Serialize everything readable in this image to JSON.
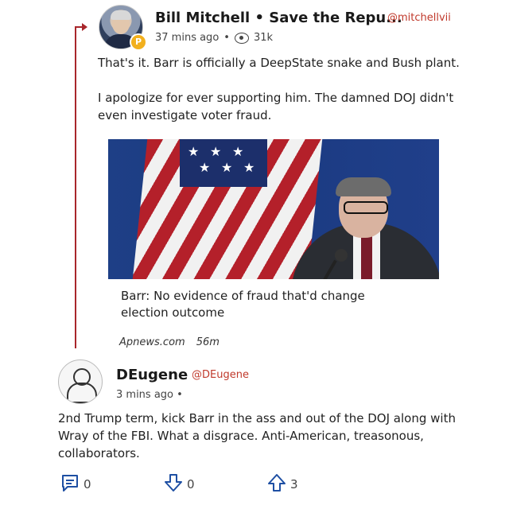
{
  "post": {
    "author_name": "Bill Mitchell • Save the Repu...",
    "author_handle": "@mitchellvii",
    "time": "37 mins ago",
    "separator": "•",
    "views": "31k",
    "badge_glyph": "P",
    "text": "That's it. Barr is officially a DeepState snake and Bush plant.\n\nI apologize for ever supporting him. The damned DOJ didn't even investigate voter fraud.",
    "article": {
      "caption": "Barr: No evidence of fraud that'd change election outcome",
      "source": "Apnews.com",
      "age": "56m"
    }
  },
  "reply": {
    "author_name": "DEugene",
    "author_handle": "@DEugene",
    "time": "3 mins ago",
    "separator": "•",
    "text": "2nd Trump term, kick Barr in the ass and out of the DOJ along with Wray of the FBI. What a disgrace. Anti-American, treasonous, collaborators.",
    "actions": {
      "comments": "0",
      "downvotes": "0",
      "upvotes": "3"
    }
  },
  "colors": {
    "accent": "#c0392b",
    "thread_line": "#a8262b",
    "badge": "#f2b01e"
  },
  "icons": [
    "eye-icon",
    "comment-icon",
    "downvote-arrow-icon",
    "upvote-arrow-icon",
    "thread-arrow-icon"
  ]
}
